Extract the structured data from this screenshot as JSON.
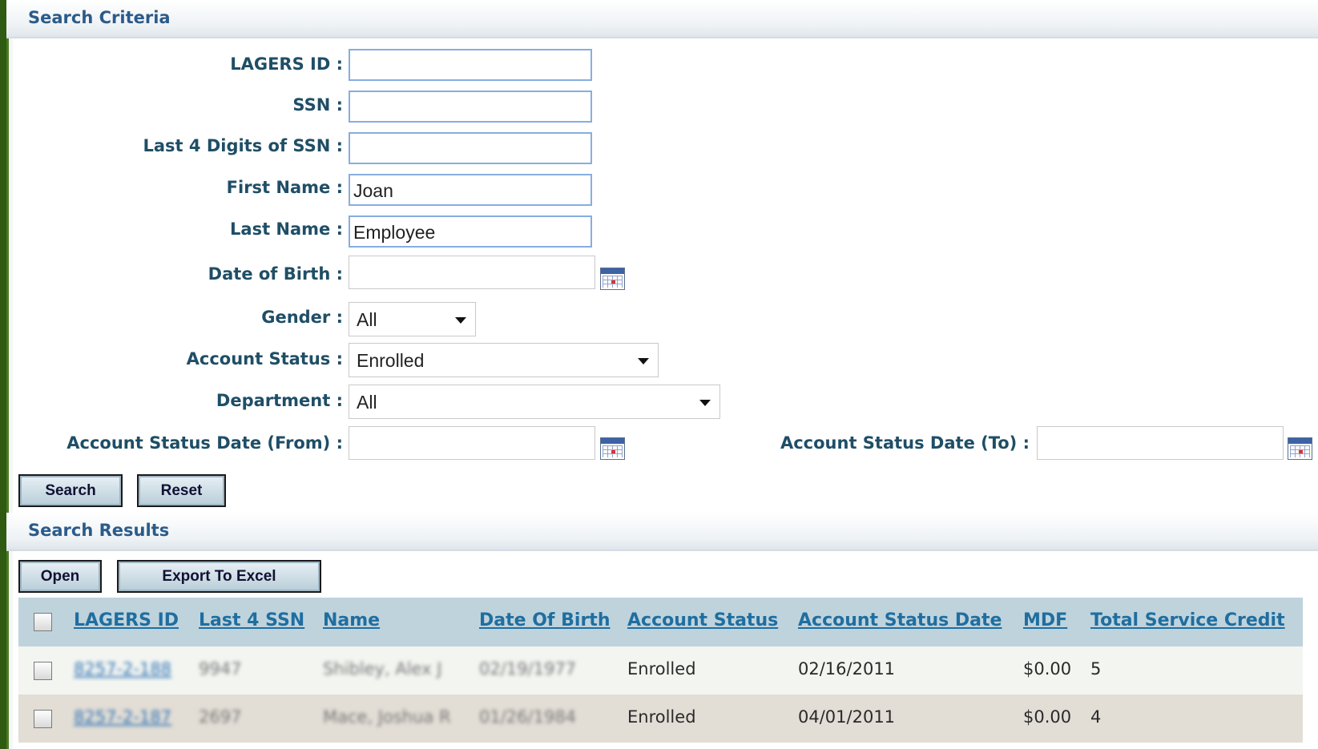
{
  "criteria": {
    "title": "Search Criteria",
    "fields": {
      "lagers_id_label": "LAGERS ID :",
      "lagers_id_value": "",
      "ssn_label": "SSN :",
      "ssn_value": "",
      "last4_label": "Last 4 Digits of SSN :",
      "last4_value": "",
      "first_name_label": "First Name :",
      "first_name_value": "Joan",
      "last_name_label": "Last Name :",
      "last_name_value": "Employee",
      "dob_label": "Date of Birth :",
      "dob_value": "",
      "gender_label": "Gender :",
      "gender_value": "All",
      "account_status_label": "Account Status :",
      "account_status_value": "Enrolled",
      "department_label": "Department :",
      "department_value": "All",
      "status_date_from_label": "Account Status Date (From) :",
      "status_date_from_value": "",
      "status_date_to_label": "Account Status Date (To) :",
      "status_date_to_value": ""
    },
    "buttons": {
      "search": "Search",
      "reset": "Reset"
    }
  },
  "results": {
    "title": "Search Results",
    "buttons": {
      "open": "Open",
      "export": "Export To Excel"
    },
    "columns": [
      "LAGERS ID",
      "Last 4 SSN",
      "Name",
      "Date Of Birth",
      "Account Status",
      "Account Status Date",
      "MDF",
      "Total Service Credit"
    ],
    "rows": [
      {
        "lagers_id": "8257-2-188",
        "last4": "9947",
        "name": "Shibley, Alex J",
        "dob": "02/19/1977",
        "status": "Enrolled",
        "status_date": "02/16/2011",
        "mdf": "$0.00",
        "credit": "5"
      },
      {
        "lagers_id": "8257-2-187",
        "last4": "2697",
        "name": "Mace, Joshua R",
        "dob": "01/26/1984",
        "status": "Enrolled",
        "status_date": "04/01/2011",
        "mdf": "$0.00",
        "credit": "4"
      }
    ]
  },
  "colors": {
    "page_border": "#2f5a12",
    "label_text": "#1f4e66",
    "header_title": "#2b5b8a",
    "link": "#1f6ea0",
    "grid_header_bg": "#bfd3dc"
  },
  "icons": {
    "calendar": "calendar-icon",
    "dropdown": "chevron-down-icon"
  }
}
